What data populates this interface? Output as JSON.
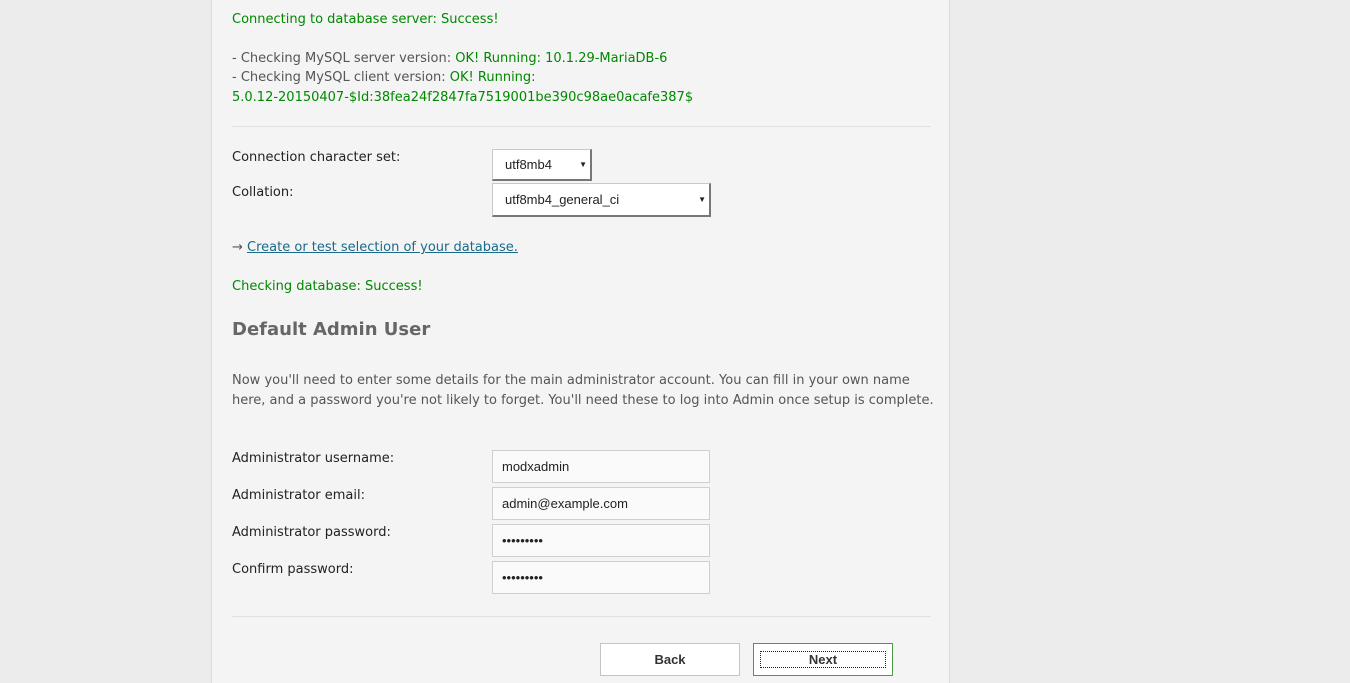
{
  "status": {
    "connecting_prefix": "Connecting to database server: ",
    "connecting_result": "Success!",
    "server_prefix": "- Checking MySQL server version: ",
    "server_result": "OK! Running: 10.1.29-MariaDB-6",
    "client_prefix": "- Checking MySQL client version: ",
    "client_result_line1": "OK! Running:",
    "client_result_line2": "5.0.12-20150407-$Id:38fea24f2847fa7519001be390c98ae0acafe387$"
  },
  "charset": {
    "charset_label": "Connection character set:",
    "charset_value": "utf8mb4",
    "collation_label": "Collation:",
    "collation_value": "utf8mb4_general_ci",
    "arrow": "→",
    "create_link": "Create or test selection of your database.",
    "check_prefix": "Checking database: ",
    "check_result": "Success!"
  },
  "admin": {
    "heading": "Default Admin User",
    "description": "Now you'll need to enter some details for the main administrator account. You can fill in your own name here, and a password you're not likely to forget. You'll need these to log into Admin once setup is complete.",
    "username_label": "Administrator username:",
    "username_value": "modxadmin",
    "email_label": "Administrator email:",
    "email_value": "admin@example.com",
    "password_label": "Administrator password:",
    "password_value": "•••••••••",
    "confirm_label": "Confirm password:",
    "confirm_value": "•••••••••"
  },
  "buttons": {
    "back": "Back",
    "next": "Next"
  },
  "colors": {
    "success": "#008800",
    "link": "#1a6a8a",
    "next_border": "#4a9a4a"
  }
}
